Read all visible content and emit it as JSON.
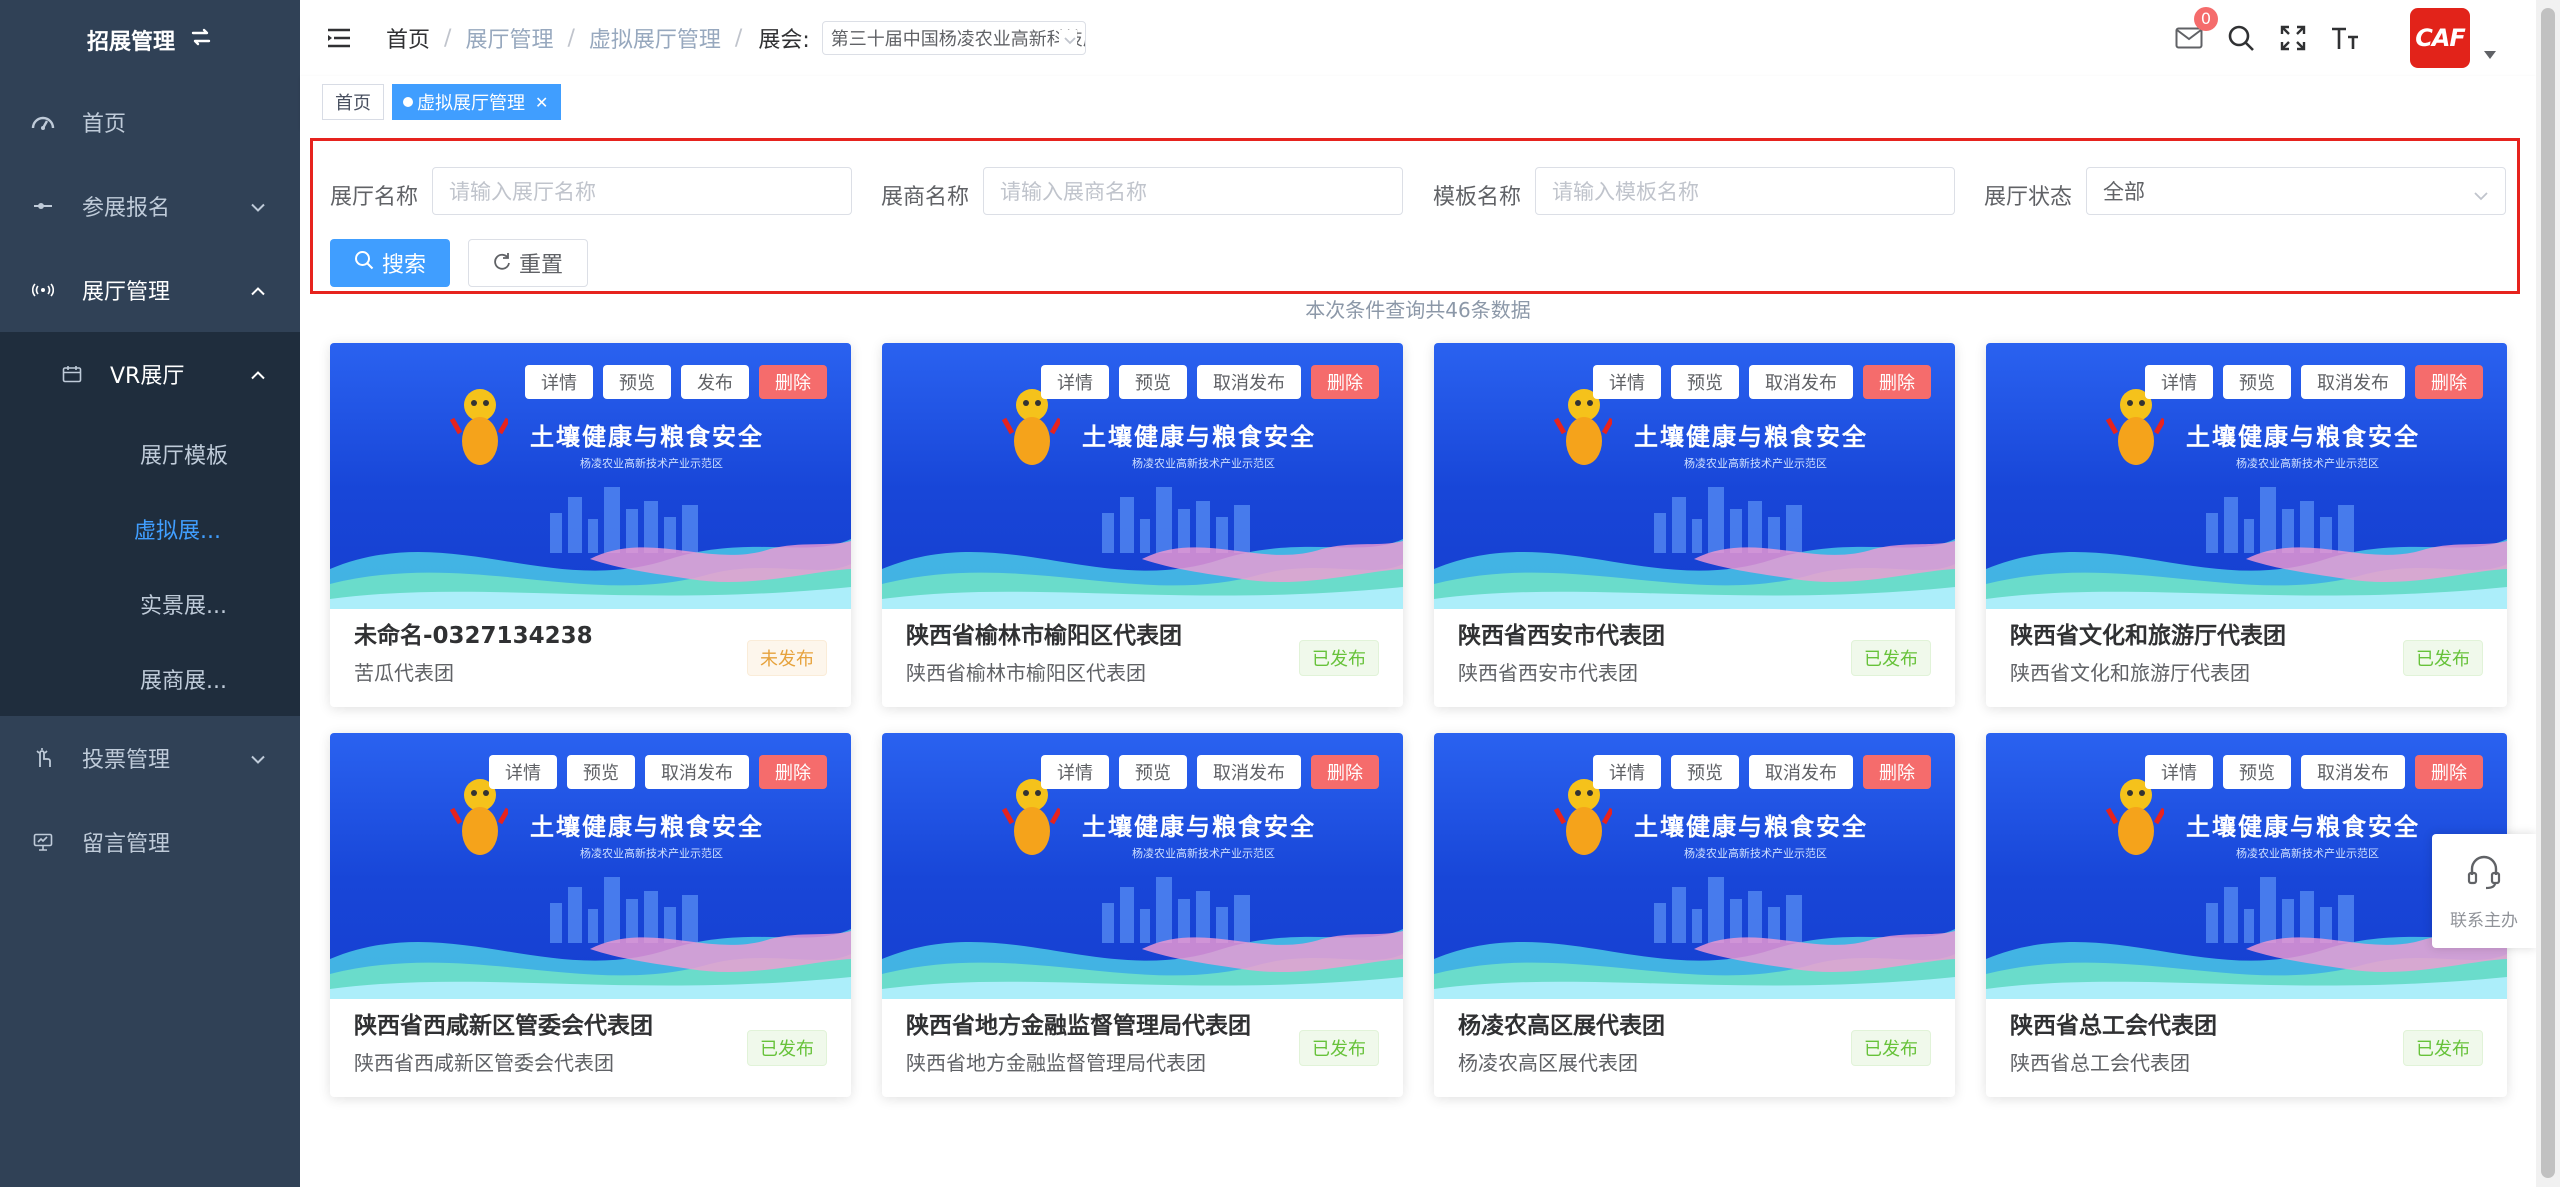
{
  "sidebar": {
    "title": "招展管理",
    "menu": [
      {
        "label": "首页",
        "icon": "dashboard-icon"
      },
      {
        "label": "参展报名",
        "icon": "signup-icon"
      },
      {
        "label": "展厅管理",
        "icon": "broadcast-icon"
      },
      {
        "label": "投票管理",
        "icon": "vote-icon"
      },
      {
        "label": "留言管理",
        "icon": "monitor-icon"
      }
    ],
    "vr_group": {
      "label": "VR展厅",
      "icon": "calendar-icon"
    },
    "leaves": [
      "展厅模板",
      "虚拟展...",
      "实景展...",
      "展商展..."
    ]
  },
  "header": {
    "breadcrumbs": [
      "首页",
      "展厅管理",
      "虚拟展厅管理"
    ],
    "expo_label": "展会:",
    "expo_value": "第三十届中国杨凌农业高新科技成果博览会",
    "mail_badge": "0",
    "avatar_text": "CAF"
  },
  "tags": [
    "首页",
    "虚拟展厅管理"
  ],
  "filters": {
    "name_label": "展厅名称",
    "name_placeholder": "请输入展厅名称",
    "exhibitor_label": "展商名称",
    "exhibitor_placeholder": "请输入展商名称",
    "template_label": "模板名称",
    "template_placeholder": "请输入模板名称",
    "status_label": "展厅状态",
    "status_value": "全部",
    "search_btn": "搜索",
    "reset_btn": "重置"
  },
  "result_text": "本次条件查询共46条数据",
  "card_banner": "土壤健康与粮食安全",
  "card_banner_small": "杨凌农业高新技术产业示范区",
  "actions": {
    "detail": "详情",
    "preview": "预览",
    "publish": "发布",
    "unpublish": "取消发布",
    "delete": "删除"
  },
  "cards": [
    {
      "title": "未命名-0327134238",
      "sub": "苦瓜代表团",
      "status": "未发布",
      "published": false
    },
    {
      "title": "陕西省榆林市榆阳区代表团",
      "sub": "陕西省榆林市榆阳区代表团",
      "status": "已发布",
      "published": true
    },
    {
      "title": "陕西省西安市代表团",
      "sub": "陕西省西安市代表团",
      "status": "已发布",
      "published": true
    },
    {
      "title": "陕西省文化和旅游厅代表团",
      "sub": "陕西省文化和旅游厅代表团",
      "status": "已发布",
      "published": true
    },
    {
      "title": "陕西省西咸新区管委会代表团",
      "sub": "陕西省西咸新区管委会代表团",
      "status": "已发布",
      "published": true
    },
    {
      "title": "陕西省地方金融监督管理局代表团",
      "sub": "陕西省地方金融监督管理局代表团",
      "status": "已发布",
      "published": true
    },
    {
      "title": "杨凌农高区展代表团",
      "sub": "杨凌农高区展代表团",
      "status": "已发布",
      "published": true
    },
    {
      "title": "陕西省总工会代表团",
      "sub": "陕西省总工会代表团",
      "status": "已发布",
      "published": true
    }
  ],
  "contact_label": "联系主办",
  "colors": {
    "primary": "#409eff",
    "sidebar_bg": "#304156",
    "danger": "#f56c6c",
    "success": "#67c23a",
    "warning": "#e6a23c"
  }
}
